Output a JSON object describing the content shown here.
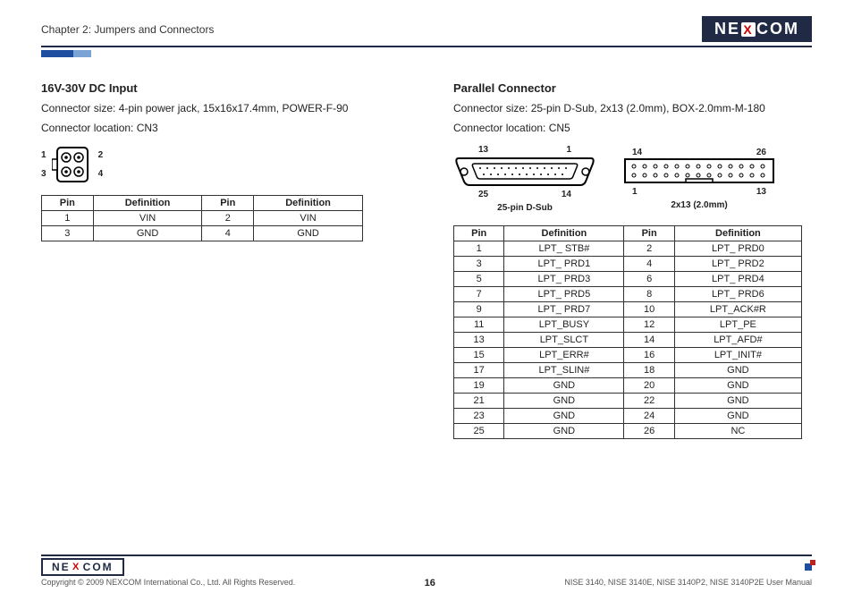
{
  "header": {
    "chapter": "Chapter 2: Jumpers and Connectors",
    "logo_left": "NE",
    "logo_x": "X",
    "logo_right": "COM"
  },
  "left": {
    "title": "16V-30V DC Input",
    "size": "Connector size: 4-pin power jack, 15x16x17.4mm, POWER-F-90",
    "location": "Connector location: CN3",
    "fig_labels": {
      "l1": "1",
      "l3": "3",
      "r2": "2",
      "r4": "4"
    },
    "table": {
      "headers": {
        "pin": "Pin",
        "def": "Definition"
      },
      "rows": [
        {
          "p1": "1",
          "d1": "VIN",
          "p2": "2",
          "d2": "VIN"
        },
        {
          "p1": "3",
          "d1": "GND",
          "p2": "4",
          "d2": "GND"
        }
      ]
    }
  },
  "right": {
    "title": "Parallel Connector",
    "size": "Connector size:  25-pin D-Sub, 2x13 (2.0mm), BOX-2.0mm-M-180",
    "location": "Connector location: CN5",
    "dsub": {
      "tl": "13",
      "tr": "1",
      "bl": "25",
      "br": "14",
      "caption": "25-pin D-Sub"
    },
    "box": {
      "tl": "14",
      "tr": "26",
      "bl": "1",
      "br": "13",
      "caption": "2x13 (2.0mm)"
    },
    "table": {
      "headers": {
        "pin": "Pin",
        "def": "Definition"
      },
      "rows": [
        {
          "p1": "1",
          "d1": "LPT_ STB#",
          "p2": "2",
          "d2": "LPT_ PRD0"
        },
        {
          "p1": "3",
          "d1": "LPT_ PRD1",
          "p2": "4",
          "d2": "LPT_ PRD2"
        },
        {
          "p1": "5",
          "d1": "LPT_ PRD3",
          "p2": "6",
          "d2": "LPT_ PRD4"
        },
        {
          "p1": "7",
          "d1": "LPT_ PRD5",
          "p2": "8",
          "d2": "LPT_ PRD6"
        },
        {
          "p1": "9",
          "d1": "LPT_ PRD7",
          "p2": "10",
          "d2": "LPT_ACK#R"
        },
        {
          "p1": "11",
          "d1": "LPT_BUSY",
          "p2": "12",
          "d2": "LPT_PE"
        },
        {
          "p1": "13",
          "d1": "LPT_SLCT",
          "p2": "14",
          "d2": "LPT_AFD#"
        },
        {
          "p1": "15",
          "d1": "LPT_ERR#",
          "p2": "16",
          "d2": "LPT_INIT#"
        },
        {
          "p1": "17",
          "d1": "LPT_SLIN#",
          "p2": "18",
          "d2": "GND"
        },
        {
          "p1": "19",
          "d1": "GND",
          "p2": "20",
          "d2": "GND"
        },
        {
          "p1": "21",
          "d1": "GND",
          "p2": "22",
          "d2": "GND"
        },
        {
          "p1": "23",
          "d1": "GND",
          "p2": "24",
          "d2": "GND"
        },
        {
          "p1": "25",
          "d1": "GND",
          "p2": "26",
          "d2": "NC"
        }
      ]
    }
  },
  "footer": {
    "copyright": "Copyright © 2009 NEXCOM International Co., Ltd. All Rights Reserved.",
    "page": "16",
    "doc": "NISE 3140, NISE 3140E, NISE 3140P2, NISE 3140P2E User Manual"
  }
}
